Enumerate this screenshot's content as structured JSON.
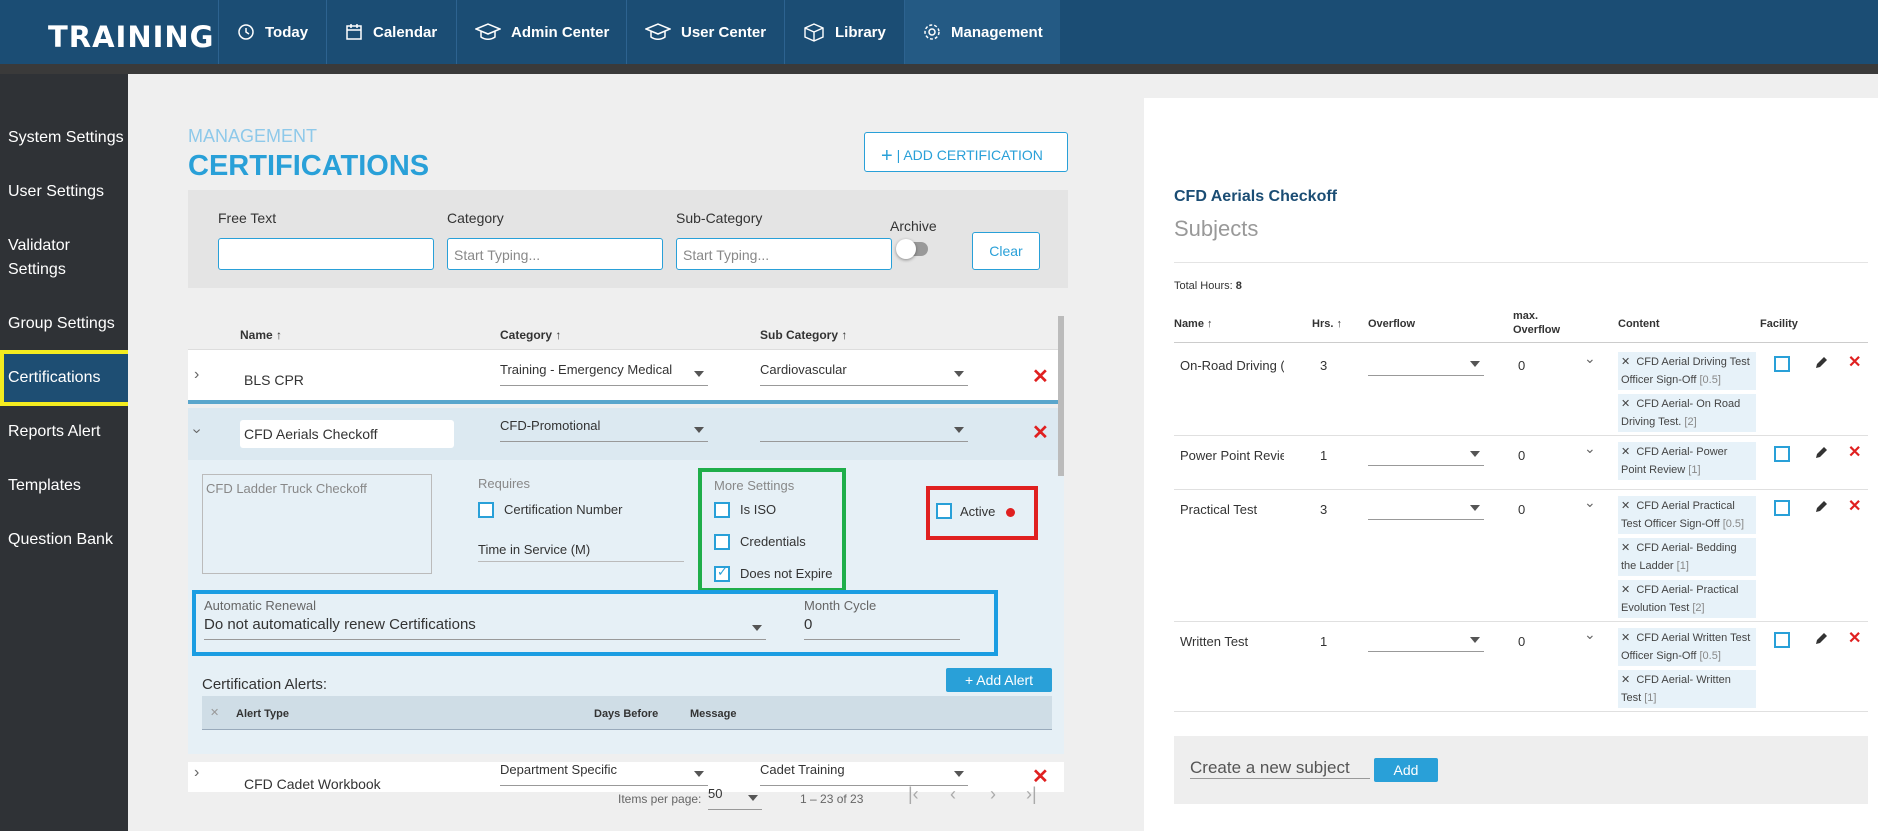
{
  "brand": "TRAINING",
  "nav": [
    {
      "label": "Today",
      "icon": "clock-icon"
    },
    {
      "label": "Calendar",
      "icon": "calendar-icon"
    },
    {
      "label": "Admin Center",
      "icon": "graduation-cap-icon"
    },
    {
      "label": "User Center",
      "icon": "graduation-cap-icon"
    },
    {
      "label": "Library",
      "icon": "cube-icon"
    },
    {
      "label": "Management",
      "icon": "gear-icon",
      "active": true
    }
  ],
  "sidebar": [
    "System Settings",
    "User Settings",
    "Validator Settings",
    "Group Settings",
    "Certifications",
    "Reports Alert",
    "Templates",
    "Question Bank"
  ],
  "page": {
    "section": "MANAGEMENT",
    "title": "CERTIFICATIONS",
    "add_button": "ADD CERTIFICATION"
  },
  "filters": {
    "free_text": "Free Text",
    "category": "Category",
    "category_placeholder": "Start Typing...",
    "subcategory": "Sub-Category",
    "subcategory_placeholder": "Start Typing...",
    "archive": "Archive",
    "clear": "Clear"
  },
  "table": {
    "headers": {
      "name": "Name",
      "category": "Category",
      "subcategory": "Sub Category"
    },
    "rows": [
      {
        "name": "BLS CPR",
        "category": "Training - Emergency Medical",
        "subcategory": "Cardiovascular"
      },
      {
        "name": "CFD Aerials Checkoff",
        "category": "CFD-Promotional",
        "subcategory": ""
      },
      {
        "name": "CFD Cadet Workbook",
        "category": "Department Specific",
        "subcategory": "Cadet Training"
      }
    ]
  },
  "detail": {
    "description": "CFD Ladder Truck Checkoff",
    "requires": "Requires",
    "cert_number": "Certification Number",
    "time_in_service": "Time in Service (M)",
    "more_settings": "More Settings",
    "is_iso": "Is ISO",
    "credentials": "Credentials",
    "does_not_expire": "Does not Expire",
    "active": "Active",
    "auto_renewal_label": "Automatic Renewal",
    "auto_renewal_value": "Do not automatically renew Certifications",
    "month_cycle_label": "Month Cycle",
    "month_cycle_value": "0",
    "alerts_title": "Certification Alerts:",
    "add_alert": "Add Alert",
    "alert_headers": {
      "type": "Alert Type",
      "days": "Days Before",
      "message": "Message"
    }
  },
  "pagination": {
    "items_per_page_label": "Items per page:",
    "items_per_page": "50",
    "range": "1 – 23 of 23"
  },
  "right": {
    "cert_name": "CFD Aerials Checkoff",
    "subjects_title": "Subjects",
    "total_hours_label": "Total Hours:",
    "total_hours": "8",
    "headers": {
      "name": "Name",
      "hrs": "Hrs.",
      "overflow": "Overflow",
      "max1": "max.",
      "max2": "Overflow",
      "content": "Content",
      "facility": "Facility"
    },
    "rows": [
      {
        "name": "On-Road Driving (",
        "hrs": "3",
        "max": "0",
        "content": [
          {
            "t": "CFD Aerial Driving Test Officer Sign-Off",
            "n": "[0.5]"
          },
          {
            "t": "CFD Aerial- On Road Driving Test.",
            "n": "[2]"
          }
        ]
      },
      {
        "name": "Power Point Revie",
        "hrs": "1",
        "max": "0",
        "content": [
          {
            "t": "CFD Aerial- Power Point Review",
            "n": "[1]"
          }
        ]
      },
      {
        "name": "Practical Test",
        "hrs": "3",
        "max": "0",
        "content": [
          {
            "t": "CFD Aerial Practical Test Officer Sign-Off",
            "n": "[0.5]"
          },
          {
            "t": "CFD Aerial- Bedding the Ladder",
            "n": "[1]"
          },
          {
            "t": "CFD Aerial- Practical Evolution Test",
            "n": "[2]"
          }
        ]
      },
      {
        "name": "Written Test",
        "hrs": "1",
        "max": "0",
        "content": [
          {
            "t": "CFD Aerial Written Test Officer Sign-Off",
            "n": "[0.5]"
          },
          {
            "t": "CFD Aerial- Written Test",
            "n": "[1]"
          }
        ]
      }
    ],
    "new_subject_placeholder": "Create a new subject",
    "add": "Add"
  }
}
